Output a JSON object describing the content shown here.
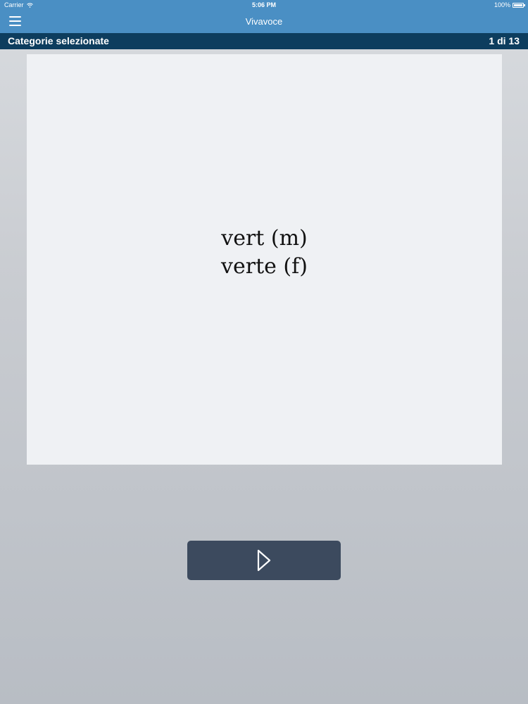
{
  "status_bar": {
    "carrier": "Carrier",
    "time": "5:06 PM",
    "battery": "100%"
  },
  "nav": {
    "title": "Vivavoce",
    "menu_icon": "hamburger-menu-icon"
  },
  "category_bar": {
    "label": "Categorie selezionate",
    "counter": "1 di 13"
  },
  "card": {
    "line1": "vert (m)",
    "line2": "verte (f)"
  },
  "controls": {
    "next_icon": "play-icon"
  },
  "colors": {
    "nav_blue": "#4a8fc4",
    "category_bar": "#0d3d5e",
    "card_bg": "#eff1f4",
    "button_bg": "#3c4a5e"
  }
}
